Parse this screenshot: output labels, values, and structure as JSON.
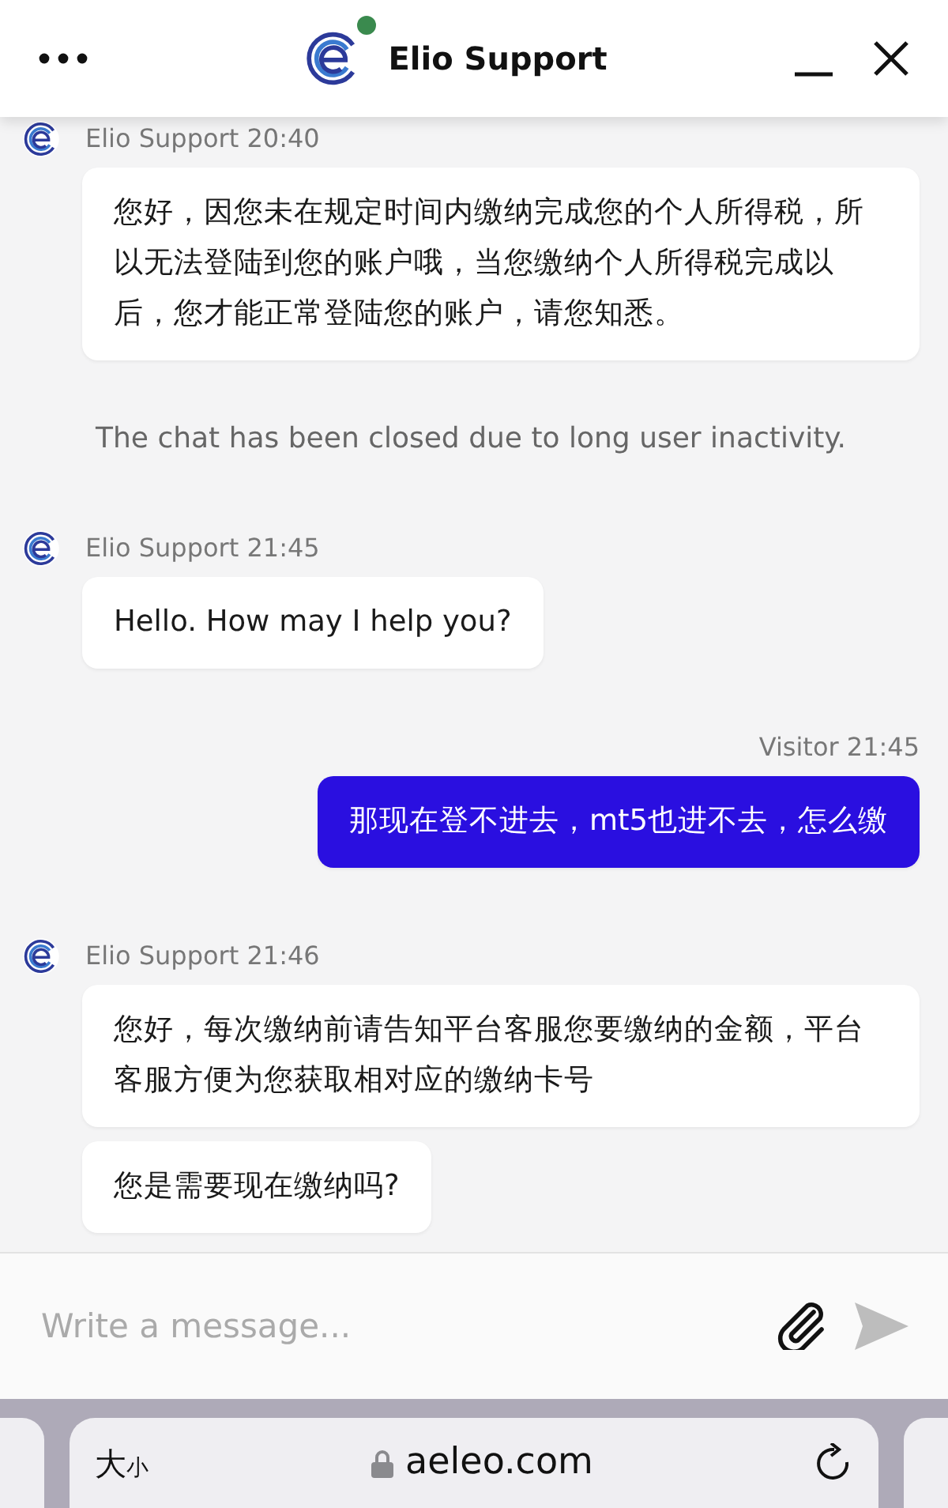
{
  "header": {
    "title": "Elio Support",
    "online": true
  },
  "messages": [
    {
      "kind": "agent",
      "meta": "Elio Support 20:40",
      "bubbles": [
        "您好，因您未在规定时间内缴纳完成您的个人所得税，所以无法登陆到您的账户哦，当您缴纳个人所得税完成以后，您才能正常登陆您的账户，请您知悉。"
      ]
    },
    {
      "kind": "system",
      "text": "The chat has been closed due to long user inactivity."
    },
    {
      "kind": "agent",
      "meta": "Elio Support 21:45",
      "bubbles": [
        "Hello. How may I help you?"
      ]
    },
    {
      "kind": "visitor",
      "meta": "Visitor 21:45",
      "bubbles": [
        "那现在登不进去，mt5也进不去，怎么缴"
      ]
    },
    {
      "kind": "agent",
      "meta": "Elio Support 21:46",
      "bubbles": [
        "您好，每次缴纳前请告知平台客服您要缴纳的金额，平台客服方便为您获取相对应的缴纳卡号",
        "您是需要现在缴纳吗?"
      ]
    }
  ],
  "composer": {
    "placeholder": "Write a message..."
  },
  "browser": {
    "text_size": [
      "大",
      "小"
    ],
    "url": "aeleo.com"
  }
}
